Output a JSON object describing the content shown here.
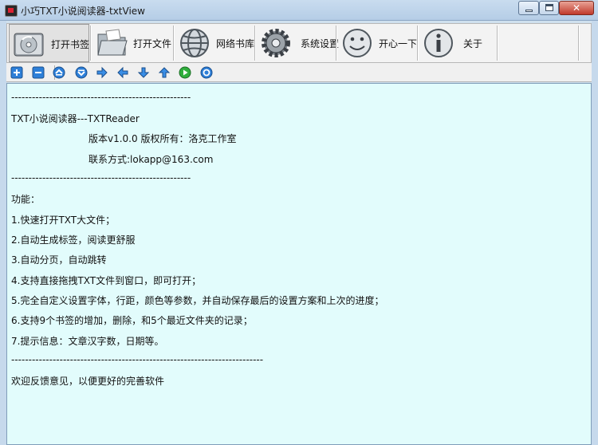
{
  "window": {
    "title": "小巧TXT小说阅读器-txtView",
    "minimize": "minimize",
    "maximize": "maximize",
    "close": "✕"
  },
  "toolbar": {
    "items": [
      {
        "label": "打开书签",
        "icon": "bookmark-disk-icon"
      },
      {
        "label": "打开文件",
        "icon": "folder-icon"
      },
      {
        "label": "网络书库",
        "icon": "globe-icon"
      },
      {
        "label": "系统设置",
        "icon": "gear-icon"
      },
      {
        "label": "开心一下",
        "icon": "smiley-icon"
      },
      {
        "label": "关于",
        "icon": "info-icon"
      }
    ]
  },
  "small_toolbar": {
    "icons": [
      "zoom-in-icon",
      "zoom-out-icon",
      "scroll-up-icon",
      "scroll-down-icon",
      "arrow-right-icon",
      "arrow-left-icon",
      "arrow-down-icon",
      "arrow-up-icon",
      "play-icon",
      "refresh-icon"
    ]
  },
  "content": {
    "lines": [
      "----------------------------------------------------",
      "TXT小说阅读器---TXTReader",
      "版本v1.0.0 版权所有：洛克工作室",
      "联系方式:lokapp@163.com",
      "----------------------------------------------------",
      "功能：",
      "1.快速打开TXT大文件；",
      "2.自动生成标签，阅读更舒服",
      "3.自动分页，自动跳转",
      "4.支持直接拖拽TXT文件到窗口，即可打开；",
      "5.完全自定义设置字体，行距，颜色等参数，并自动保存最后的设置方案和上次的进度；",
      "6.支持9个书签的增加，删除，和5个最近文件夹的记录；",
      "7.提示信息：文章汉字数，日期等。",
      "-------------------------------------------------------------------------",
      "欢迎反馈意见，以便更好的完善软件"
    ]
  },
  "colors": {
    "content_bg": "#e2fcfc",
    "titlebar": "#b5cde6",
    "close_button": "#c0392b"
  }
}
